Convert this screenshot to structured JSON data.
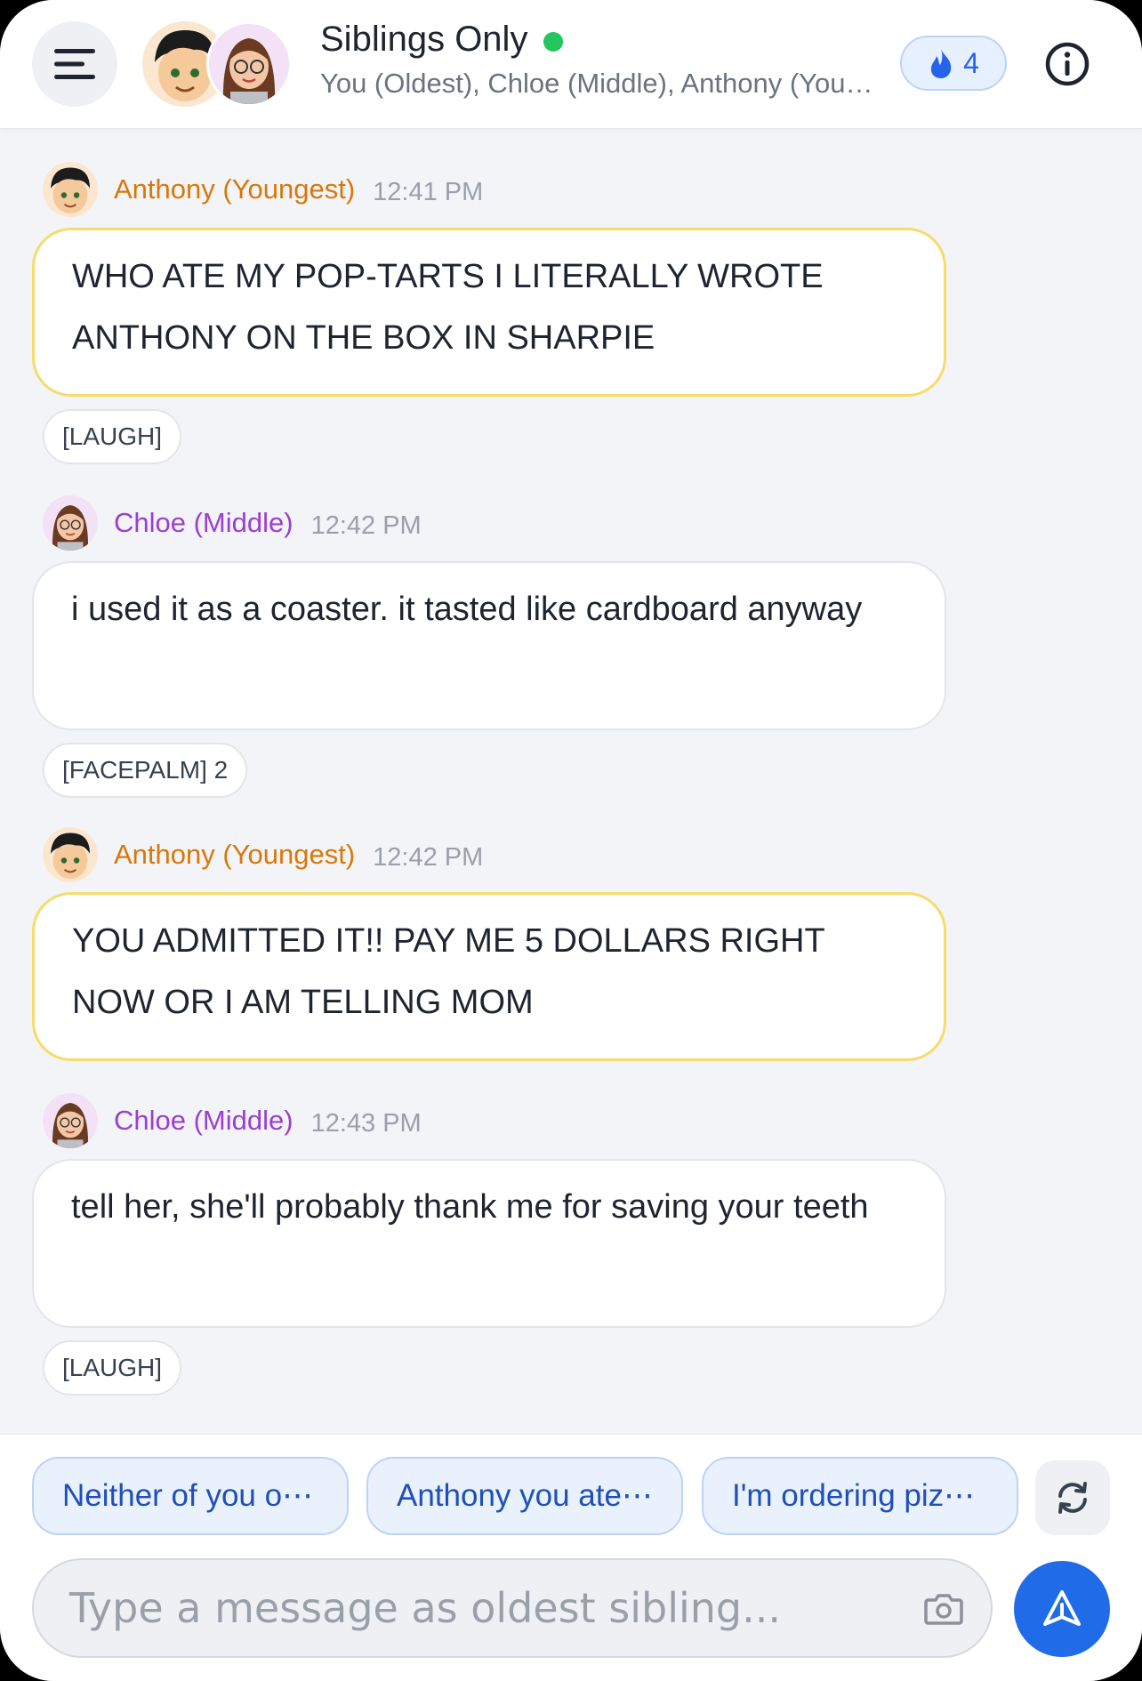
{
  "header": {
    "title": "Siblings Only",
    "subtitle": "You (Oldest), Chloe (Middle), Anthony (You…",
    "streak_count": "4"
  },
  "messages": [
    {
      "sender": "Anthony (Youngest)",
      "time": "12:41 PM",
      "text": "WHO ATE MY POP-TARTS I LITERALLY WROTE ANTHONY ON THE BOX IN SHARPIE",
      "reaction": "[LAUGH]"
    },
    {
      "sender": "Chloe (Middle)",
      "time": "12:42 PM",
      "text": "i used it as a coaster. it tasted like cardboard anyway",
      "reaction": "[FACEPALM] 2"
    },
    {
      "sender": "Anthony (Youngest)",
      "time": "12:42 PM",
      "text": "YOU ADMITTED IT!! PAY ME 5 DOLLARS RIGHT NOW OR I AM TELLING MOM"
    },
    {
      "sender": "Chloe (Middle)",
      "time": "12:43 PM",
      "text": "tell her, she'll probably thank me for saving your teeth",
      "reaction": "[LAUGH]"
    }
  ],
  "suggestions": [
    "Neither of you o⋯",
    "Anthony you ate⋯",
    "I'm ordering piz⋯"
  ],
  "composer": {
    "placeholder": "Type a message as oldest sibling..."
  },
  "colors": {
    "accent": "#1f6be8",
    "anthony": "#d9770a",
    "chloe": "#9b3fd1",
    "online": "#22c55e",
    "highlight_border": "#f6dc6a"
  },
  "icons": [
    "menu-icon",
    "flame-icon",
    "info-icon",
    "refresh-icon",
    "camera-icon",
    "send-icon"
  ]
}
